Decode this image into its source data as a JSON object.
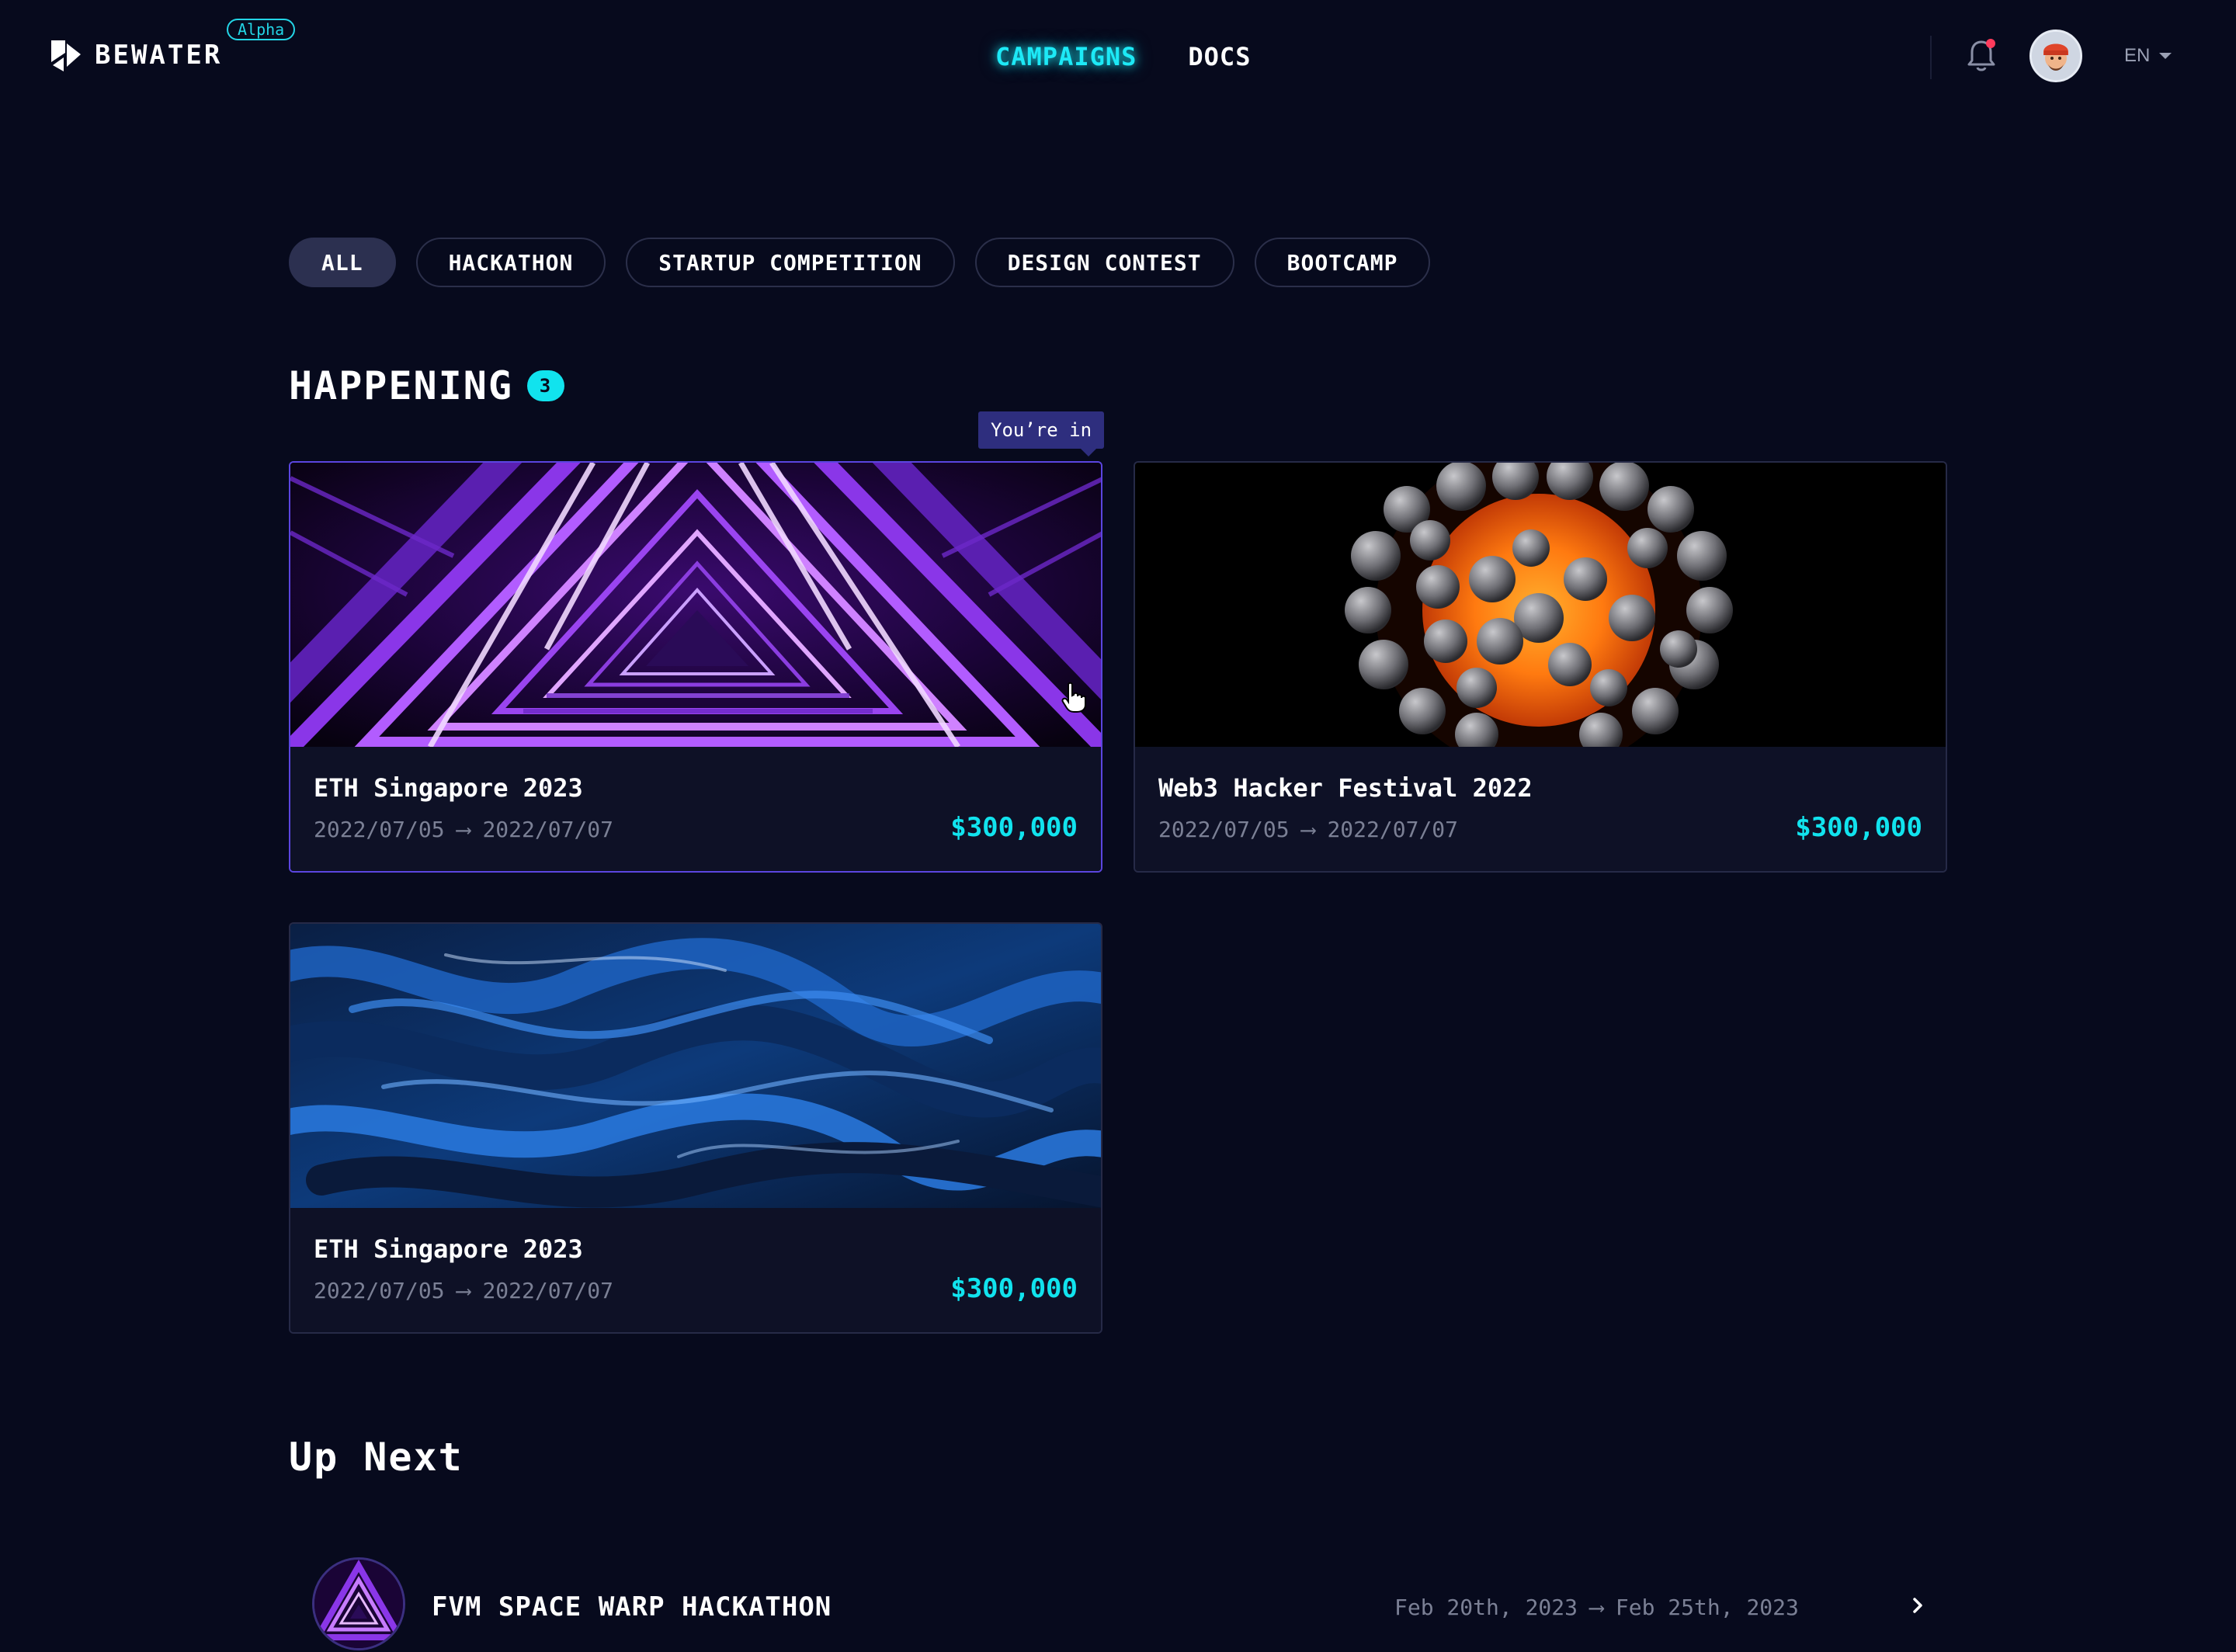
{
  "header": {
    "brand": "BEWATER",
    "badge": "Alpha",
    "nav": [
      "CAMPAIGNS",
      "DOCS"
    ],
    "active_nav": "CAMPAIGNS",
    "language": "EN",
    "has_notification": true,
    "icons": [
      "logo-mark-icon",
      "bell-icon",
      "chevron-down-icon"
    ]
  },
  "filters": {
    "items": [
      "ALL",
      "HACKATHON",
      "STARTUP COMPETITION",
      "DESIGN CONTEST",
      "BOOTCAMP"
    ],
    "active": "ALL"
  },
  "happening": {
    "title": "HAPPENING",
    "count": "3",
    "tooltip": "You’re in",
    "cards": [
      {
        "title": "ETH Singapore 2023",
        "start": "2022/07/05",
        "end": "2022/07/07",
        "prize": "$300,000",
        "image": "purple-triangle-tunnel"
      },
      {
        "title": "Web3 Hacker Festival 2022",
        "start": "2022/07/05",
        "end": "2022/07/07",
        "prize": "$300,000",
        "image": "orange-sphere-with-gray-balls"
      },
      {
        "title": "ETH Singapore 2023",
        "start": "2022/07/05",
        "end": "2022/07/07",
        "prize": "$300,000",
        "image": "blue-marble-fluid"
      }
    ]
  },
  "upnext": {
    "title": "Up Next",
    "items": [
      {
        "name": "FVM SPACE WARP HACKATHON",
        "start": "Feb 20th, 2023",
        "end": "Feb 25th, 2023"
      }
    ]
  },
  "colors": {
    "background": "#070a1d",
    "accent": "#11e3ee",
    "selected_border": "#5b45e0",
    "notification_dot": "#ff3b5c"
  }
}
